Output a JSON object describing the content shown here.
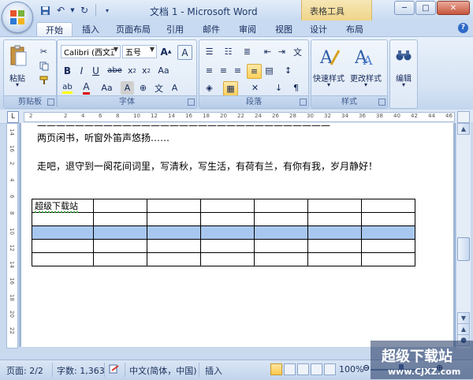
{
  "window": {
    "title": "文档 1 - Microsoft Word",
    "context_tab_group": "表格工具"
  },
  "quick_access": [
    "save-icon",
    "undo-icon",
    "redo-icon",
    "customize-icon"
  ],
  "tabs": [
    {
      "label": "开始",
      "active": true
    },
    {
      "label": "插入"
    },
    {
      "label": "页面布局"
    },
    {
      "label": "引用"
    },
    {
      "label": "邮件"
    },
    {
      "label": "审阅"
    },
    {
      "label": "视图"
    },
    {
      "label": "设计"
    },
    {
      "label": "布局"
    }
  ],
  "ribbon": {
    "clipboard": {
      "label": "剪贴板",
      "paste": "粘贴"
    },
    "font": {
      "label": "字体",
      "font_name": "Calibri (西文正文)",
      "font_size": "五号"
    },
    "paragraph": {
      "label": "段落"
    },
    "styles": {
      "label": "样式",
      "quick_styles": "快速样式",
      "change_styles": "更改样式"
    },
    "editing": {
      "label": "编辑"
    }
  },
  "ruler": {
    "h_ticks": [
      "2",
      "",
      "2",
      "4",
      "6",
      "8",
      "10",
      "12",
      "14",
      "16",
      "18",
      "20",
      "22",
      "24",
      "26",
      "28",
      "30",
      "32",
      "34",
      "36",
      "38",
      "40",
      "42",
      "44",
      "46"
    ],
    "v_ticks": [
      "14",
      "16",
      "2",
      "4",
      "6",
      "8",
      "10",
      "12",
      "14",
      "16",
      "18",
      "20",
      "22"
    ]
  },
  "document": {
    "line_cut": "了一墙的月影，……（上一行文字，部分被截断）",
    "line1": "两页闲书，听窗外笛声悠扬……",
    "line2": "走吧，退守到一阕花间词里，写清秋，写生活，有荷有兰，有你有我，岁月静好！",
    "table": {
      "first_cell": "超级下载站",
      "rows": 5,
      "cols": 7,
      "selected_row": 3
    }
  },
  "status": {
    "page": "页面: 2/2",
    "words": "字数: 1,363",
    "language": "中文(简体，中国)",
    "mode": "插入",
    "zoom": "100%",
    "zoom_value": 100
  },
  "watermark": {
    "text": "超级下载站",
    "url": "www.CJXZ.com"
  },
  "colors": {
    "accent": "#c9d9ee",
    "selection": "#a8c7ef",
    "context_tab": "#efd58a"
  }
}
